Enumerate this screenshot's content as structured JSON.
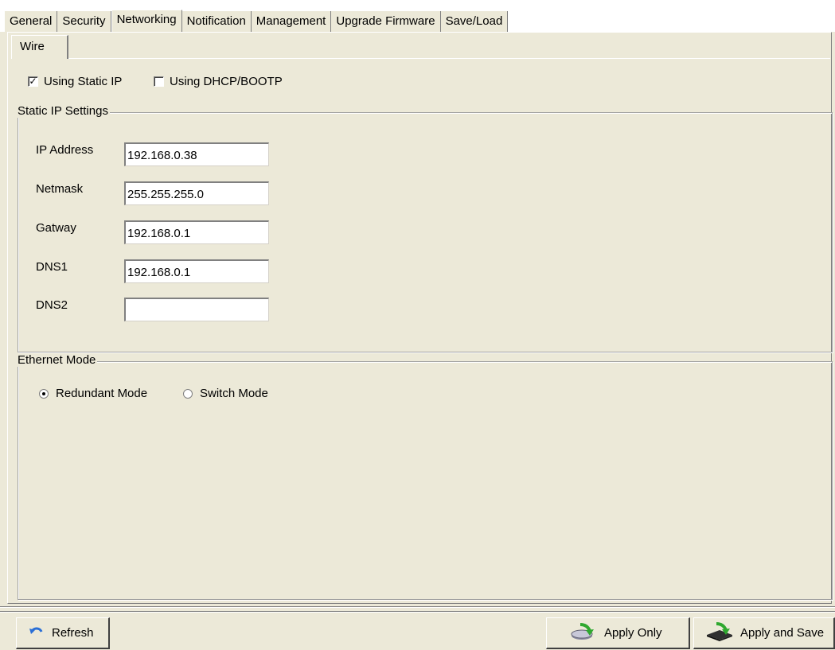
{
  "tabs": [
    {
      "label": "General"
    },
    {
      "label": "Security"
    },
    {
      "label": "Networking"
    },
    {
      "label": "Notification"
    },
    {
      "label": "Management"
    },
    {
      "label": "Upgrade Firmware"
    },
    {
      "label": "Save/Load"
    }
  ],
  "active_tab": "Networking",
  "subtab": {
    "label": "Wire"
  },
  "ip_mode": {
    "static": {
      "label": "Using Static IP",
      "checked": true
    },
    "dhcp": {
      "label": "Using DHCP/BOOTP",
      "checked": false
    }
  },
  "static_ip": {
    "legend": "Static IP Settings",
    "ip_address": {
      "label": "IP Address",
      "value": "192.168.0.38"
    },
    "netmask": {
      "label": "Netmask",
      "value": "255.255.255.0"
    },
    "gateway": {
      "label": "Gatway",
      "value": "192.168.0.1"
    },
    "dns1": {
      "label": "DNS1",
      "value": "192.168.0.1"
    },
    "dns2": {
      "label": "DNS2",
      "value": ""
    }
  },
  "ethernet_mode": {
    "legend": "Ethernet Mode",
    "redundant": {
      "label": "Redundant Mode",
      "selected": true
    },
    "switch": {
      "label": "Switch Mode",
      "selected": false
    }
  },
  "buttons": {
    "refresh": {
      "label": "Refresh",
      "icon": "refresh-icon"
    },
    "apply_only": {
      "label": "Apply Only",
      "icon": "apply-disk-icon"
    },
    "apply_and_save": {
      "label": "Apply and Save",
      "icon": "apply-save-chip-icon"
    }
  },
  "colors": {
    "window_bg": "#ece9d8",
    "refresh_icon": "#2a6fd6",
    "apply_arrow": "#2fa82f"
  }
}
